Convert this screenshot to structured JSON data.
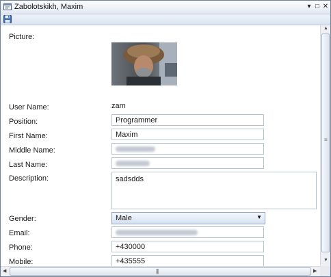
{
  "window": {
    "title": "Zabolotskikh, Maxim",
    "icons": {
      "title": "window-form-icon",
      "save": "floppy-save-icon"
    },
    "buttons": {
      "dropdown": "▾",
      "maximize": "□",
      "close": "✕"
    }
  },
  "form": {
    "picture_label": "Picture:",
    "user_name_label": "User Name:",
    "user_name_value": "zam",
    "position_label": "Position:",
    "position_value": "Programmer",
    "first_name_label": "First Name:",
    "first_name_value": "Maxim",
    "middle_name_label": "Middle Name:",
    "last_name_label": "Last Name:",
    "description_label": "Description:",
    "description_value": "sadsdds",
    "gender_label": "Gender:",
    "gender_value": "Male",
    "email_label": "Email:",
    "phone_label": "Phone:",
    "phone_value": "+430000",
    "mobile_label": "Mobile:",
    "mobile_value": "+435555"
  },
  "colors": {
    "accent": "#6f7f96",
    "field_border": "#b5c2d4"
  }
}
